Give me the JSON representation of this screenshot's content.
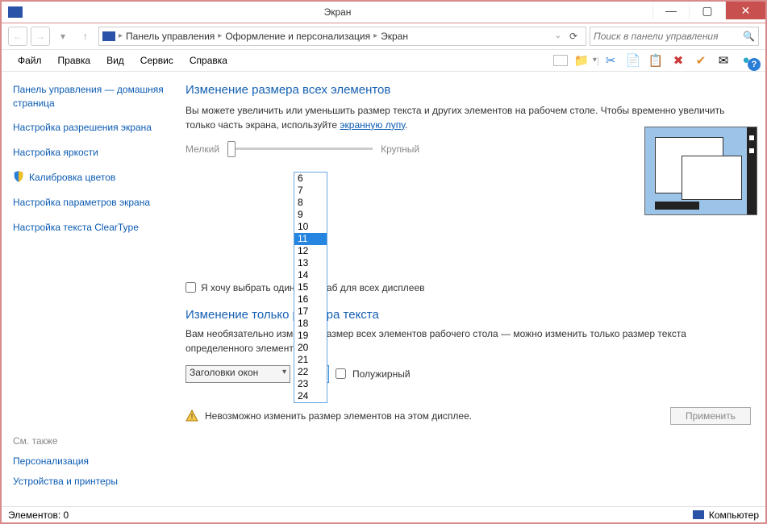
{
  "titlebar": {
    "title": "Экран"
  },
  "nav": {
    "crumbs": [
      "Панель управления",
      "Оформление и персонализация",
      "Экран"
    ],
    "search_placeholder": "Поиск в панели управления"
  },
  "menu": {
    "items": [
      "Файл",
      "Правка",
      "Вид",
      "Сервис",
      "Справка"
    ]
  },
  "sidebar": {
    "home": "Панель управления — домашняя страница",
    "links": [
      "Настройка разрешения экрана",
      "Настройка яркости",
      "Калибровка цветов",
      "Настройка параметров экрана",
      "Настройка текста ClearType"
    ],
    "see_also_head": "См. также",
    "see_also": [
      "Персонализация",
      "Устройства и принтеры"
    ]
  },
  "main": {
    "heading1": "Изменение размера всех элементов",
    "desc1_a": "Вы можете увеличить или уменьшить размер текста и других элементов на рабочем столе. Чтобы временно увеличить только часть экрана, используйте ",
    "desc1_link": "экранную лупу",
    "desc1_b": ".",
    "slider_small": "Мелкий",
    "slider_large": "Крупный",
    "cb_one_scale": "Я хочу выбрать один масштаб для всех дисплеев",
    "heading2": "Изменение только размера текста",
    "desc2": "Вам необязательно изменять размер всех элементов рабочего стола — можно изменить только размер текста определенного элемента.",
    "element_select": "Заголовки окон",
    "size_select": "11",
    "cb_bold": "Полужирный",
    "warn": "Невозможно изменить размер элементов на этом дисплее.",
    "apply": "Применить",
    "size_options": [
      "6",
      "7",
      "8",
      "9",
      "10",
      "11",
      "12",
      "13",
      "14",
      "15",
      "16",
      "17",
      "18",
      "19",
      "20",
      "21",
      "22",
      "23",
      "24"
    ]
  },
  "status": {
    "elements": "Элементов: 0",
    "right": "Компьютер"
  }
}
